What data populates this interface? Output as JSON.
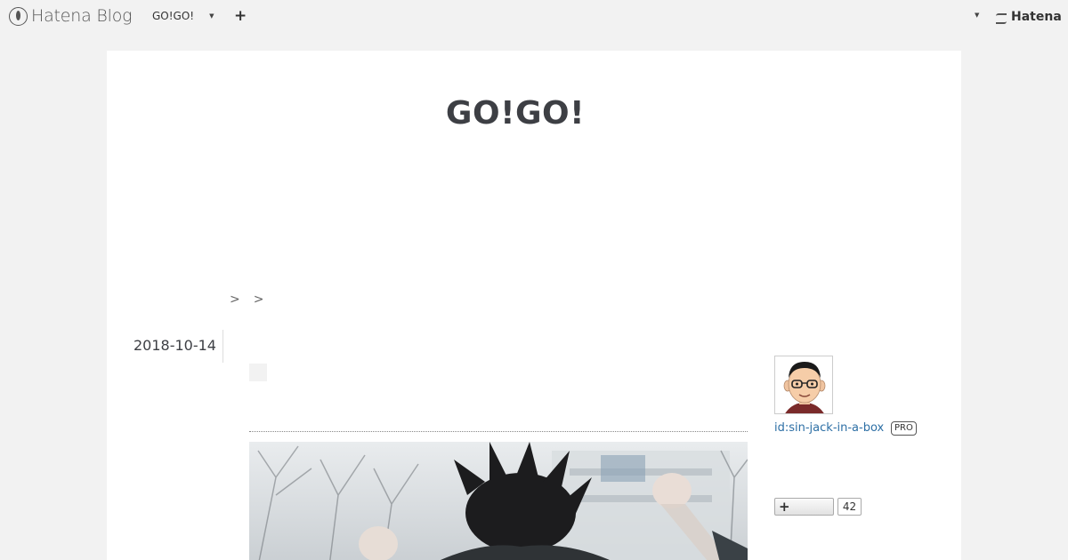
{
  "global_header": {
    "logo_text": "Hatena Blog",
    "blog_menu_label": "GO!GO!",
    "add_label": "+",
    "hatena_label": "Hatena"
  },
  "blog": {
    "title": "GO!GO!"
  },
  "breadcrumb": {
    "separators": [
      ">",
      ">"
    ]
  },
  "entry": {
    "date": "2018-10-14"
  },
  "sidebar": {
    "profile_id": "id:sin-jack-in-a-box",
    "pro_badge": "PRO",
    "follow_label": "+",
    "follow_count": "42"
  },
  "icons": {
    "logo": "hatena-blog-logo-icon",
    "dropdown": "caret-down-icon",
    "add": "plus-icon",
    "hatena": "hatena-logo-icon"
  },
  "colors": {
    "page_background": "#f2f2f2",
    "content_background": "#ffffff",
    "link": "#2d6fa5",
    "title": "#3d3f44"
  }
}
